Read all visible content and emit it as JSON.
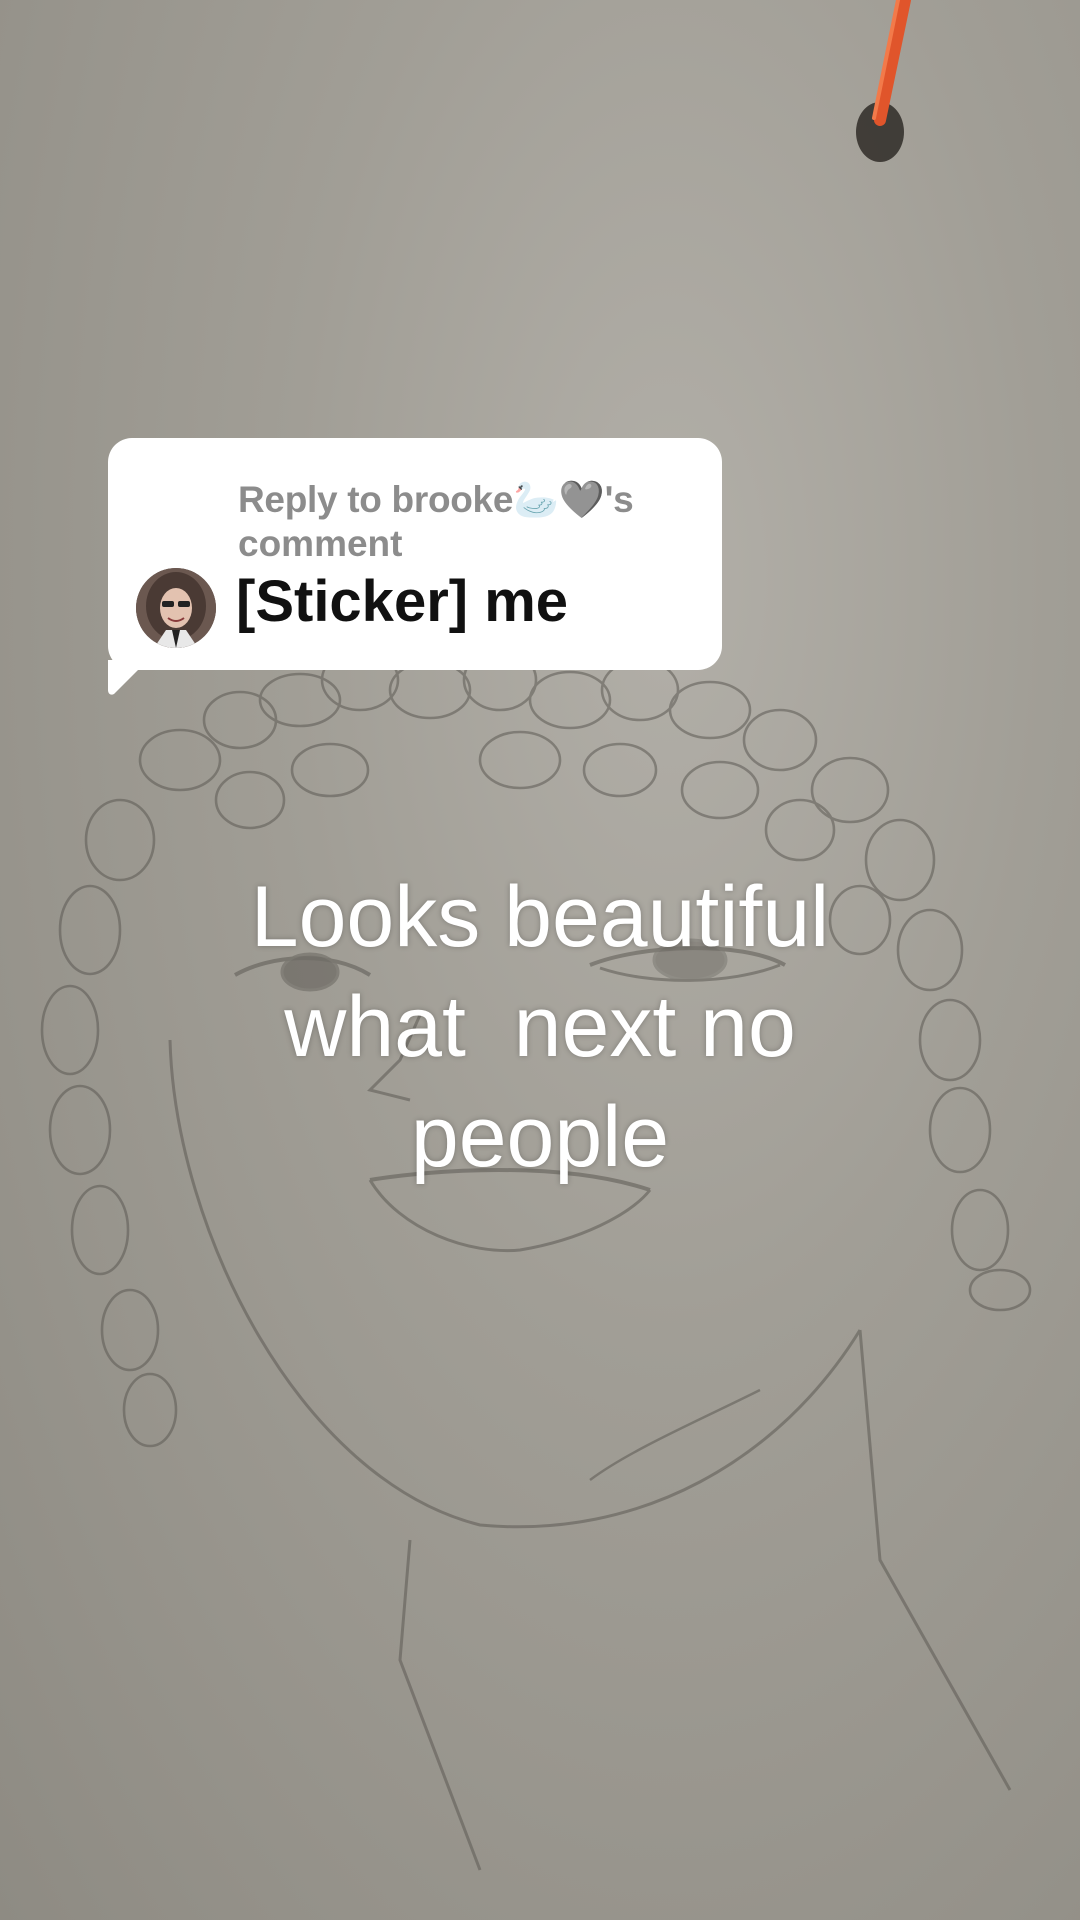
{
  "reply": {
    "prefix": "Reply to brooke",
    "emoji_swan": "🦢",
    "emoji_heart": "🩶",
    "suffix": "'s",
    "line2": "comment",
    "comment_text": "[Sticker] me"
  },
  "caption": {
    "line1": "Looks beautiful",
    "line2": "what  next no",
    "line3": "people"
  }
}
